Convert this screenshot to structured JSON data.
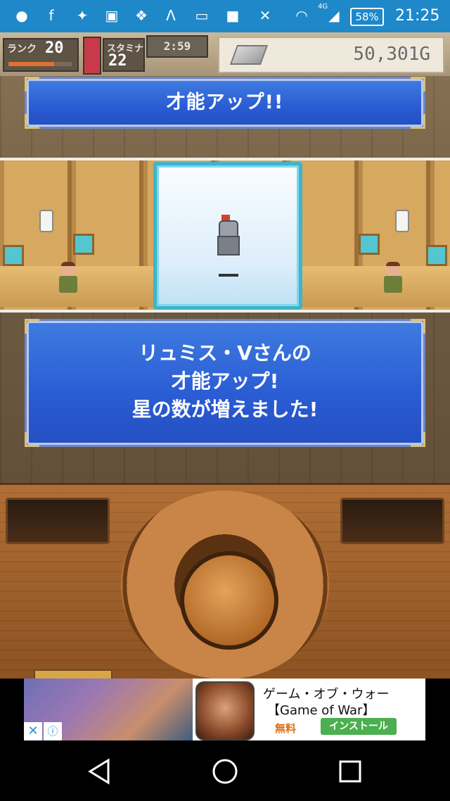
{
  "status_bar": {
    "network": "4G",
    "battery": "58%",
    "time": "21:25",
    "icons": [
      "messages-icon",
      "facebook-icon",
      "app-icon",
      "image-icon",
      "bird-icon",
      "alpha-icon",
      "tv-icon",
      "square-app-icon",
      "mute-icon",
      "wifi-icon",
      "signal-icon"
    ]
  },
  "hud": {
    "rank_label": "ランク",
    "rank_value": "20",
    "rank_progress": 0.72,
    "stamina_label": "スタミナ",
    "stamina_value": "22",
    "timer": "2:59",
    "gold": "50,301G",
    "gold_icon": "silver-bar-icon"
  },
  "banner_top": {
    "text": "才能アップ!!"
  },
  "message": {
    "lines": [
      "リュミス・Vさんの",
      "才能アップ!",
      "星の数が増えました!"
    ]
  },
  "ad": {
    "title": "ゲーム・オブ・ウォー",
    "subtitle": "【Game of War】",
    "free_label": "無料",
    "install_label": "インストール",
    "close_symbol": "✕",
    "info_symbol": "ⓘ"
  },
  "colors": {
    "status_bar": "#1e88c9",
    "banner_blue": "#2a5cd4",
    "portrait_border": "#3fb4cc",
    "install_green": "#4caf50"
  }
}
